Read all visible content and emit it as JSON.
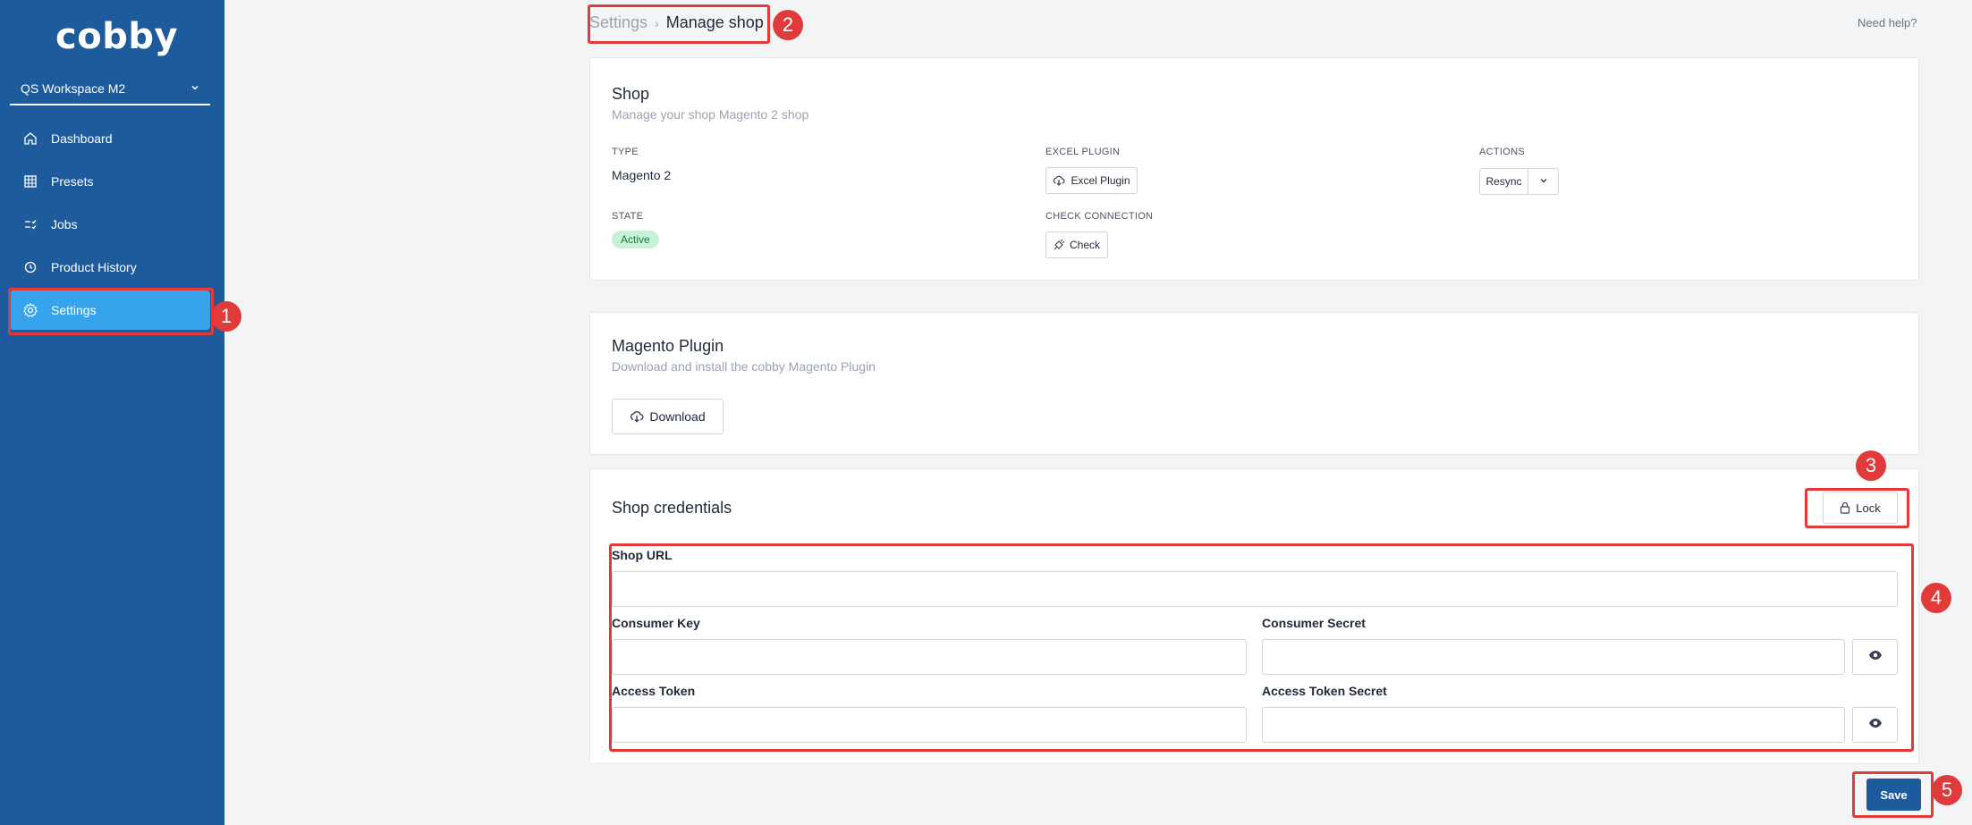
{
  "app": {
    "logo": "cobby",
    "help": "Need help?"
  },
  "sidebar": {
    "workspace": "QS Workspace M2",
    "items": [
      {
        "label": "Dashboard",
        "icon": "home-icon"
      },
      {
        "label": "Presets",
        "icon": "grid-icon"
      },
      {
        "label": "Jobs",
        "icon": "jobs-icon"
      },
      {
        "label": "Product History",
        "icon": "history-icon"
      },
      {
        "label": "Settings",
        "icon": "gear-icon",
        "active": true
      }
    ]
  },
  "breadcrumb": {
    "parent": "Settings",
    "current": "Manage shop"
  },
  "shop": {
    "title": "Shop",
    "subtitle": "Manage your shop Magento 2 shop",
    "type_label": "TYPE",
    "type_value": "Magento 2",
    "excel_label": "EXCEL PLUGIN",
    "excel_button": "Excel Plugin",
    "actions_label": "ACTIONS",
    "resync_button": "Resync",
    "state_label": "STATE",
    "state_value": "Active",
    "check_label": "CHECK CONNECTION",
    "check_button": "Check"
  },
  "plugin": {
    "title": "Magento Plugin",
    "subtitle": "Download and install the cobby Magento Plugin",
    "download_button": "Download"
  },
  "credentials": {
    "title": "Shop credentials",
    "lock_button": "Lock",
    "shop_url_label": "Shop URL",
    "shop_url_value": "",
    "consumer_key_label": "Consumer Key",
    "consumer_key_value": "",
    "consumer_secret_label": "Consumer Secret",
    "consumer_secret_value": "",
    "access_token_label": "Access Token",
    "access_token_value": "",
    "access_token_secret_label": "Access Token Secret",
    "access_token_secret_value": "",
    "save_button": "Save"
  },
  "annotations": [
    "1",
    "2",
    "3",
    "4",
    "5"
  ],
  "colors": {
    "sidebar": "#1e5b9c",
    "active": "#36a3ec",
    "annotation": "#e03a3a",
    "badge_bg": "#c8f2d8",
    "badge_text": "#15803d"
  }
}
